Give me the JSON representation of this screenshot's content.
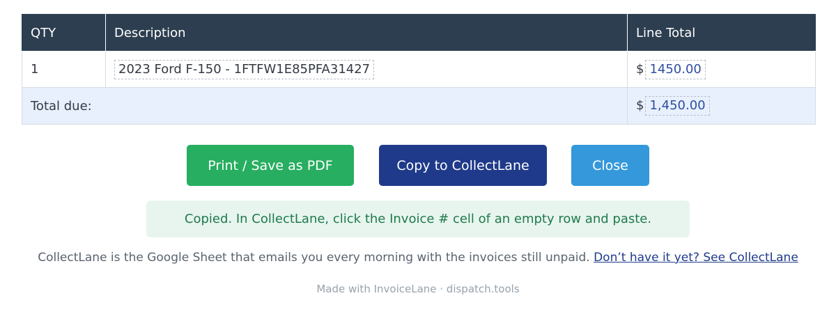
{
  "table": {
    "headers": {
      "qty": "QTY",
      "description": "Description",
      "line_total": "Line Total"
    },
    "rows": [
      {
        "qty": "1",
        "description": "2023 Ford F-150 - 1FTFW1E85PFA31427",
        "currency": "$",
        "amount": "1450.00"
      }
    ],
    "total": {
      "label": "Total due:",
      "currency": "$",
      "amount": "1,450.00"
    }
  },
  "buttons": {
    "print_label": "Print / Save as PDF",
    "copy_label": "Copy to CollectLane",
    "close_label": "Close"
  },
  "notice": {
    "text": "Copied. In CollectLane, click the Invoice # cell of an empty row and paste."
  },
  "promo": {
    "text": "CollectLane is the Google Sheet that emails you every morning with the invoices still unpaid.",
    "link_text": "Don’t have it yet? See CollectLane"
  },
  "footer": {
    "text": "Made with InvoiceLane · dispatch.tools"
  },
  "colors": {
    "header_bg": "#2c3e50",
    "total_row_bg": "#e8f0fe",
    "print_button": "#27ae60",
    "copy_button": "#1f3a8a",
    "close_button": "#3498db",
    "notice_bg": "#e8f5ee",
    "notice_text": "#1e7a4c"
  }
}
